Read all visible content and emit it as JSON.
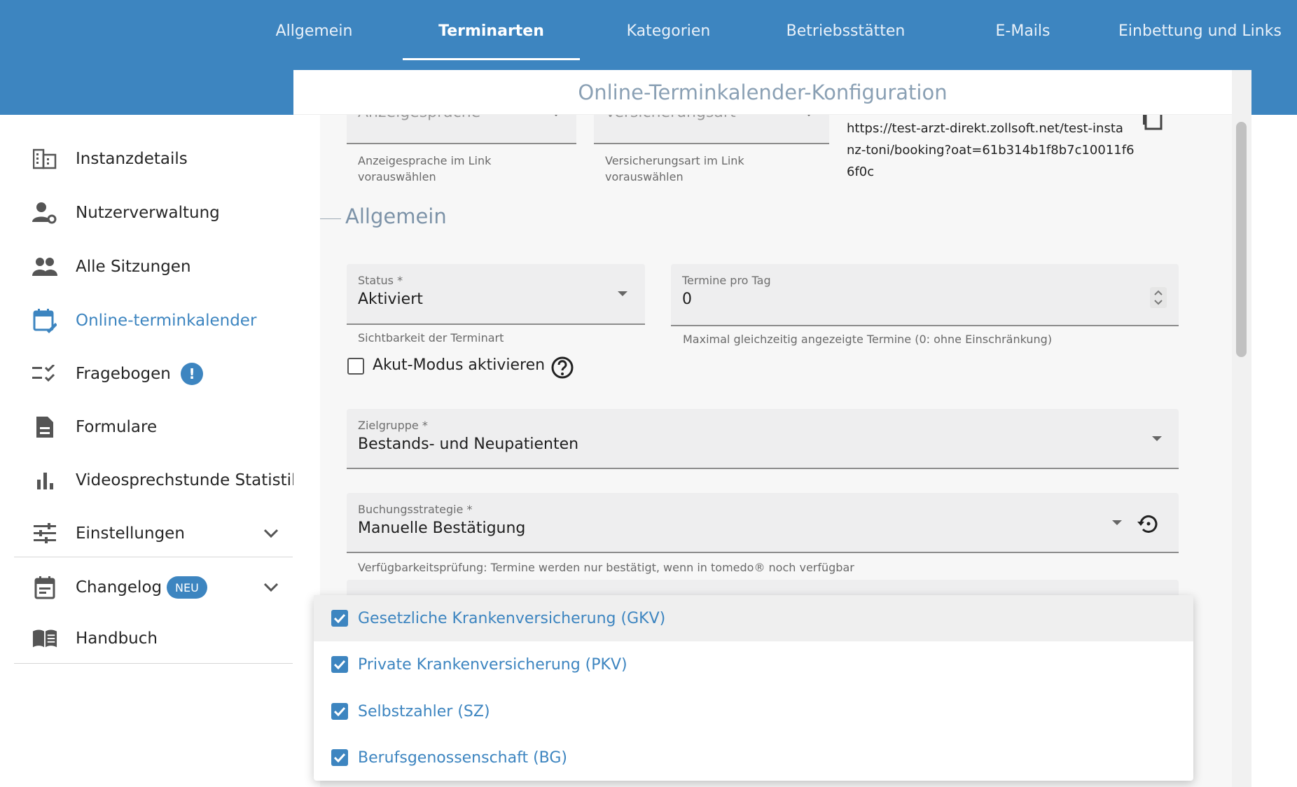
{
  "colors": {
    "primary": "#3d85c0",
    "dialog_title": "#8aa0b4",
    "section": "#7d93a8"
  },
  "tabs": [
    {
      "label": "Allgemein",
      "active": false
    },
    {
      "label": "Terminarten",
      "active": true
    },
    {
      "label": "Kategorien",
      "active": false
    },
    {
      "label": "Betriebsstätten",
      "active": false
    },
    {
      "label": "E-Mails",
      "active": false
    },
    {
      "label": "Einbettung und Links",
      "active": false
    }
  ],
  "sidebar": {
    "items": [
      {
        "label": "Instanzdetails",
        "icon": "building-icon"
      },
      {
        "label": "Nutzerverwaltung",
        "icon": "user-settings-icon"
      },
      {
        "label": "Alle Sitzungen",
        "icon": "people-icon"
      },
      {
        "label": "Online-terminkalender",
        "icon": "calendar-edit-icon",
        "active": true
      },
      {
        "label": "Fragebogen",
        "icon": "checklist-icon",
        "badge": "!"
      },
      {
        "label": "Formulare",
        "icon": "document-icon"
      },
      {
        "label": "Videosprechstunde Statistik",
        "icon": "bar-chart-icon"
      },
      {
        "label": "Einstellungen",
        "icon": "tune-icon"
      },
      {
        "label": "Changelog",
        "icon": "calendar-icon",
        "badge": "NEU"
      },
      {
        "label": "Handbuch",
        "icon": "book-icon"
      }
    ]
  },
  "dialog": {
    "title": "Online-Terminkalender-Konfiguration",
    "link_section": {
      "language_field_label": "Anzeigesprache",
      "language_hint": "Anzeigesprache im Link vorauswählen",
      "insurance_field_label": "Versicherungsart",
      "insurance_hint": "Versicherungsart im Link vorauswählen",
      "url_line1": "https://test-arzt-direkt.zollsoft.net/test-insta",
      "url_line2": "nz-toni/booking?oat=61b314b1f8b7c10011f6",
      "url_line3": "6f0c"
    },
    "section_title": "Allgemein",
    "status": {
      "label": "Status *",
      "value": "Aktiviert",
      "hint": "Sichtbarkeit der Terminart"
    },
    "termine_pro_tag": {
      "label": "Termine pro Tag",
      "value": "0",
      "hint": "Maximal gleichzeitig angezeigte Termine (0: ohne Einschränkung)"
    },
    "akut_modus": {
      "label": "Akut-Modus aktivieren",
      "checked": false
    },
    "zielgruppe": {
      "label": "Zielgruppe *",
      "value": "Bestands- und Neupatienten"
    },
    "buchungsstrategie": {
      "label": "Buchungsstrategie *",
      "value": "Manuelle Bestätigung",
      "hint": "Verfügbarkeitsprüfung: Termine werden nur bestätigt, wenn in tomedo® noch verfügbar"
    }
  },
  "insurance_options": [
    {
      "label": "Gesetzliche Krankenversicherung (GKV)",
      "checked": true
    },
    {
      "label": "Private Krankenversicherung (PKV)",
      "checked": true
    },
    {
      "label": "Selbstzahler (SZ)",
      "checked": true
    },
    {
      "label": "Berufsgenossenschaft (BG)",
      "checked": true
    }
  ]
}
